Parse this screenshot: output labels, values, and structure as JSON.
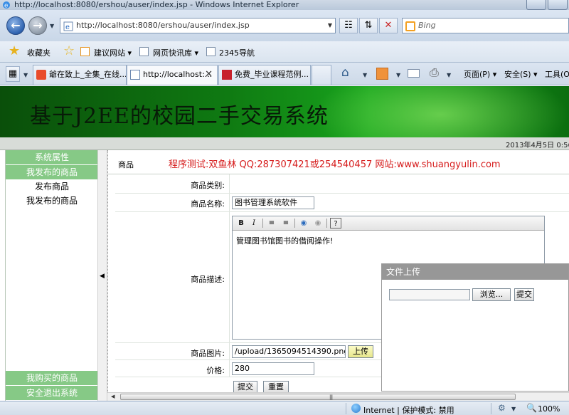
{
  "window": {
    "title": "http://localhost:8080/ershou/auser/index.jsp - Windows Internet Explorer"
  },
  "navigation": {
    "address": "http://localhost:8080/ershou/auser/index.jsp",
    "search_placeholder": "Bing"
  },
  "favorites_bar": {
    "favorites_label": "收藏夹",
    "links": [
      "建议网站 ▾",
      "网页快讯库 ▾",
      "2345导航"
    ]
  },
  "tabs": [
    {
      "label": "爺在致上_全集_在线...",
      "active": false
    },
    {
      "label": "http://localhost:...",
      "active": true
    },
    {
      "label": "免费_毕业课程范例...",
      "active": false
    }
  ],
  "command_bar": {
    "page": "页面(P) ▾",
    "safety": "安全(S) ▾",
    "tools": "工具(O)"
  },
  "banner": {
    "title": "基于J2EE的校园二手交易系统"
  },
  "datebar": {
    "date": "2013年4月5日  0:56"
  },
  "sidebar": {
    "sections": [
      {
        "label": "系统属性"
      },
      {
        "label": "我发布的商品"
      }
    ],
    "items": [
      "发布商品",
      "我发布的商品"
    ],
    "bottom_sections": [
      {
        "label": "我购买的商品"
      },
      {
        "label": "安全退出系统"
      }
    ]
  },
  "main": {
    "breadcrumb": "商品",
    "notice": "程序测试:双鱼林 QQ:287307421或254540457 网站:www.shuangyulin.com",
    "form": {
      "category_label": "商品类别:",
      "name_label": "商品名称:",
      "name_value": "图书管理系统软件",
      "desc_label": "商品描述:",
      "desc_value": "管理图书馆图书的借阅操作!",
      "image_label": "商品图片:",
      "image_value": "/upload/1365094514390.png",
      "upload_button": "上传",
      "price_label": "价格:",
      "price_value": "280",
      "submit_button": "提交",
      "reset_button": "重置"
    },
    "editor_toolbar": [
      "B",
      "I",
      "ordered-list",
      "unordered-list",
      "link",
      "unlink",
      "help"
    ]
  },
  "upload_dialog": {
    "title": "文件上传",
    "browse_button": "浏览...",
    "submit_button": "提交"
  },
  "statusbar": {
    "zone": "Internet | 保护模式: 禁用",
    "zoom": "100%"
  }
}
